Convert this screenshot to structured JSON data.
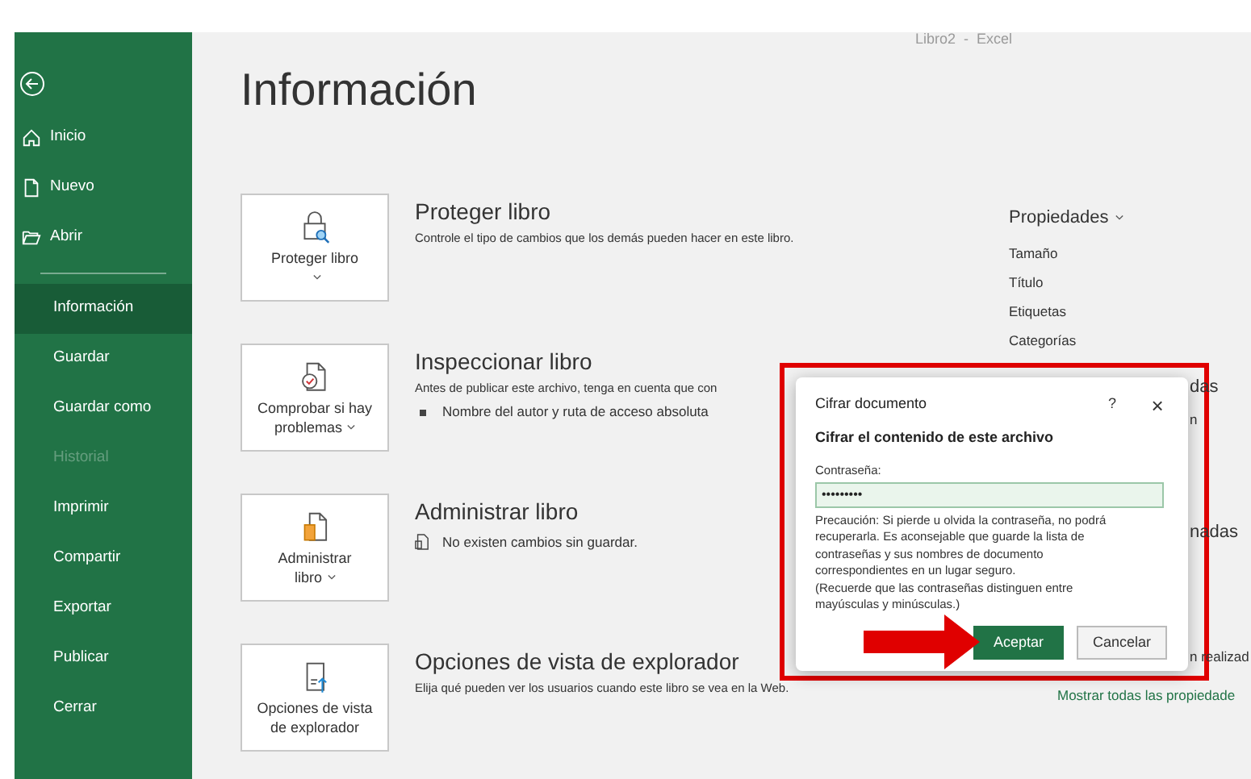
{
  "window": {
    "title": "Libro2  -  Excel"
  },
  "sidebar": {
    "items": [
      {
        "label": "Inicio",
        "selected": false,
        "disabled": false
      },
      {
        "label": "Nuevo",
        "selected": false,
        "disabled": false
      },
      {
        "label": "Abrir",
        "selected": false,
        "disabled": false
      },
      {
        "label": "Información",
        "selected": true,
        "disabled": false
      },
      {
        "label": "Guardar",
        "selected": false,
        "disabled": false
      },
      {
        "label": "Guardar como",
        "selected": false,
        "disabled": false
      },
      {
        "label": "Historial",
        "selected": false,
        "disabled": true
      },
      {
        "label": "Imprimir",
        "selected": false,
        "disabled": false
      },
      {
        "label": "Compartir",
        "selected": false,
        "disabled": false
      },
      {
        "label": "Exportar",
        "selected": false,
        "disabled": false
      },
      {
        "label": "Publicar",
        "selected": false,
        "disabled": false
      },
      {
        "label": "Cerrar",
        "selected": false,
        "disabled": false
      }
    ]
  },
  "page_title": "Información",
  "sections": [
    {
      "kind": "protect",
      "button_label": "Proteger libro",
      "title": "Proteger libro",
      "description": "Controle el tipo de cambios que los demás pueden hacer en este libro."
    },
    {
      "kind": "inspect",
      "button_label": "Comprobar si hay problemas",
      "title": "Inspeccionar libro",
      "description": "Antes de publicar este archivo, tenga en cuenta que con",
      "bullets": [
        "Nombre del autor y ruta de acceso absoluta"
      ]
    },
    {
      "kind": "manage",
      "button_label": "Administrar libro",
      "title": "Administrar libro",
      "note": "No existen cambios sin guardar."
    },
    {
      "kind": "browser",
      "button_label": "Opciones de vista de explorador",
      "title": "Opciones de vista de explorador",
      "description": "Elija qué pueden ver los usuarios cuando este libro se vea en la Web."
    }
  ],
  "properties": {
    "title": "Propiedades",
    "items": [
      "Tamaño",
      "Título",
      "Etiquetas",
      "Categorías"
    ],
    "partial_texts": [
      "das",
      "n",
      "nadas",
      "n realizad"
    ],
    "link": "Mostrar todas las propiedade"
  },
  "dialog": {
    "title": "Cifrar documento",
    "help": "?",
    "close": "×",
    "heading": "Cifrar el contenido de este archivo",
    "field_label": "Contraseña:",
    "field_value": "•••••••••",
    "paragraphs": [
      "Precaución: Si pierde u olvida la contraseña, no podrá recuperarla. Es aconsejable que guarde la lista de contraseñas y sus nombres de documento correspondientes en un lugar seguro.",
      "(Recuerde que las contraseñas distinguen entre mayúsculas y minúsculas.)"
    ],
    "buttons": [
      {
        "label": "Aceptar",
        "primary": true
      },
      {
        "label": "Cancelar",
        "primary": false
      }
    ]
  }
}
